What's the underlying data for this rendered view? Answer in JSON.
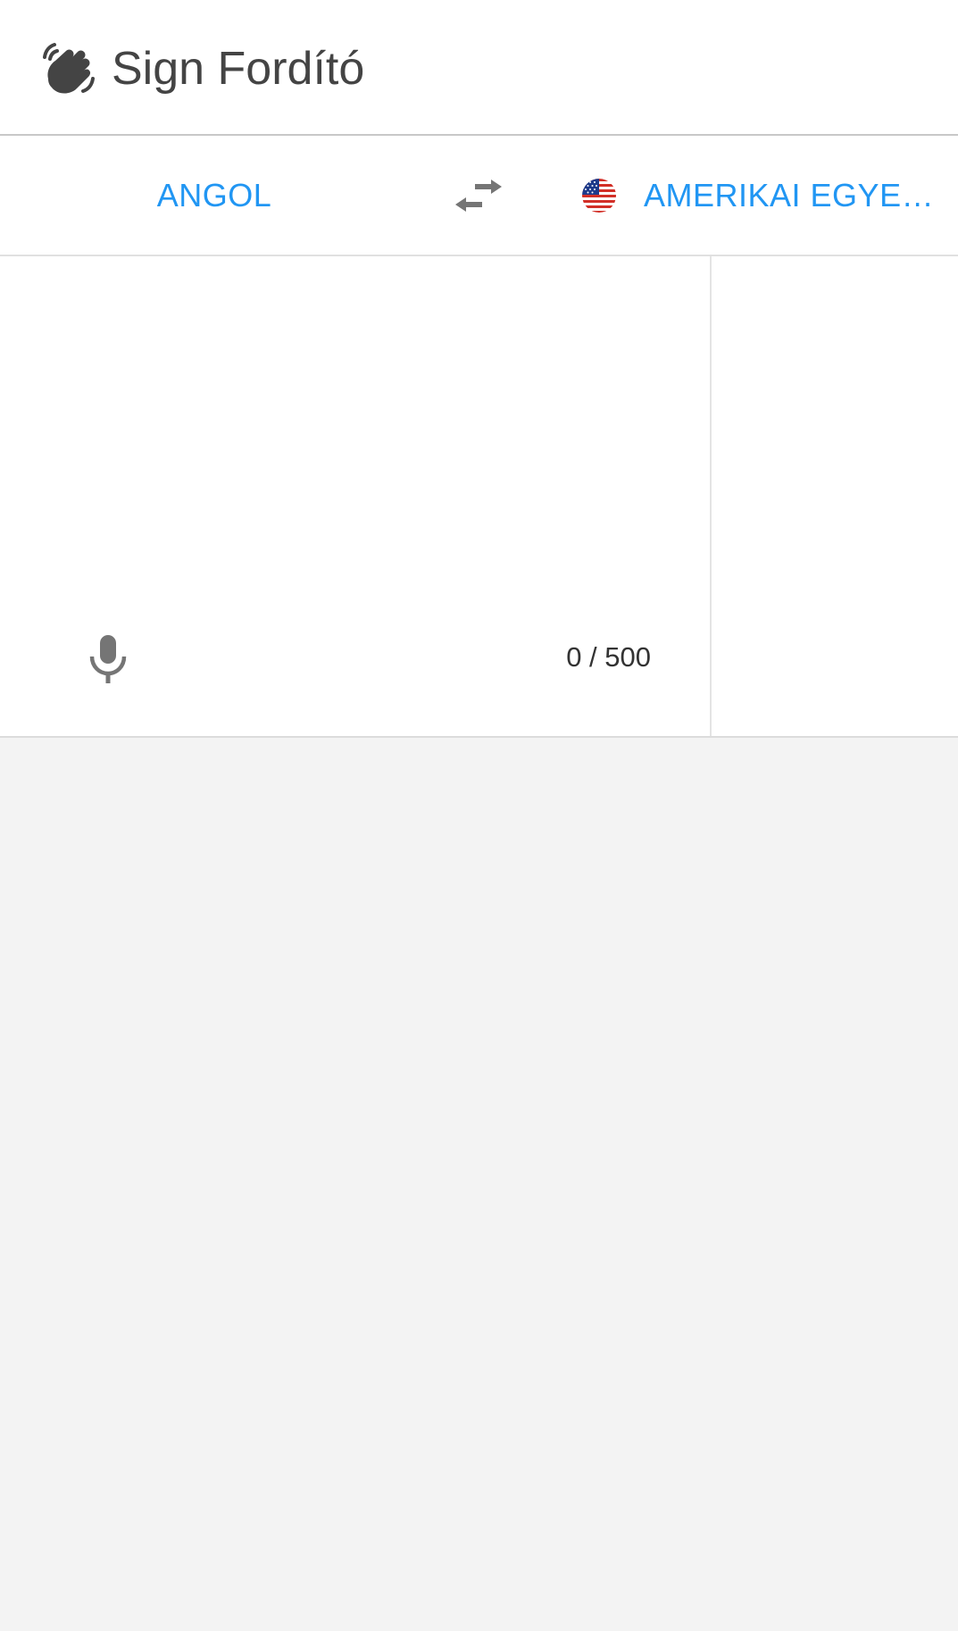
{
  "app": {
    "title": "Sign Fordító"
  },
  "language_bar": {
    "source_language": "ANGOL",
    "target_language": "AMERIKAI EGYE…",
    "target_flag": "us-flag-icon",
    "swap_icon": "swap-arrows-icon"
  },
  "translator": {
    "input_value": "",
    "char_counter": "0 / 500",
    "mic_icon": "microphone-icon"
  },
  "colors": {
    "accent": "#2196f3",
    "title": "#444444",
    "icon": "#757575",
    "background": "#f3f3f3"
  }
}
